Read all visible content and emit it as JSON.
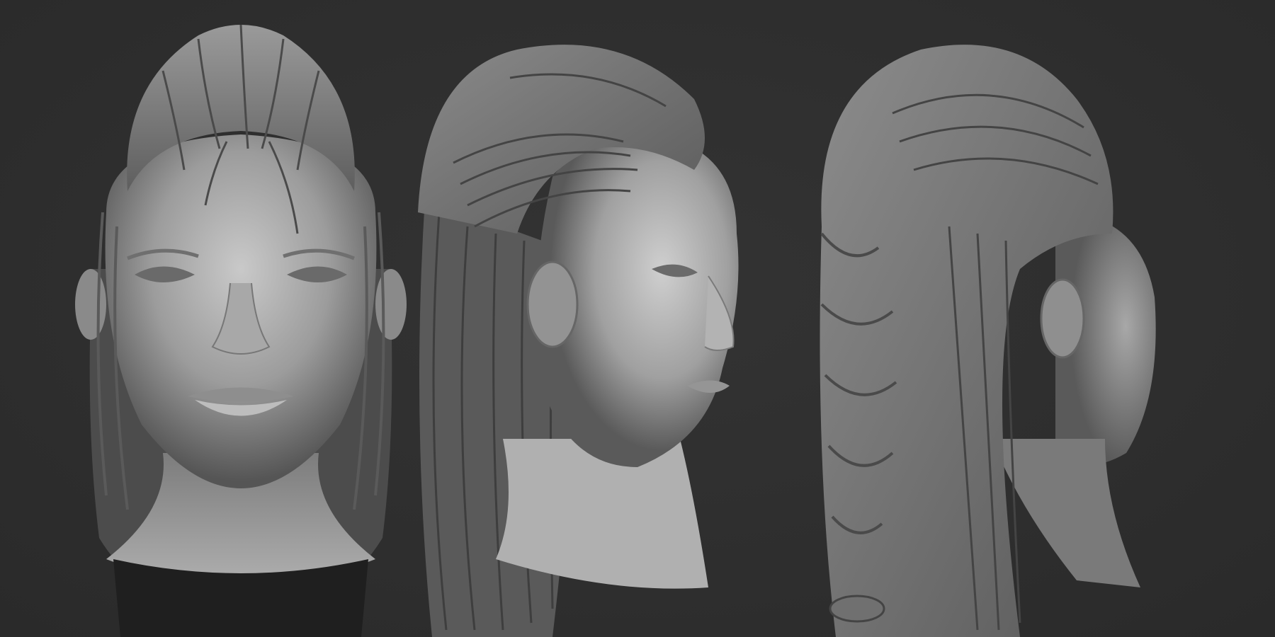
{
  "scene": {
    "background_color": "#2f2f2f",
    "material_color": "#8a8a8a",
    "views": [
      {
        "name": "front-view",
        "angle": "front"
      },
      {
        "name": "three-quarter-view",
        "angle": "three-quarter"
      },
      {
        "name": "side-view",
        "angle": "profile"
      }
    ]
  }
}
